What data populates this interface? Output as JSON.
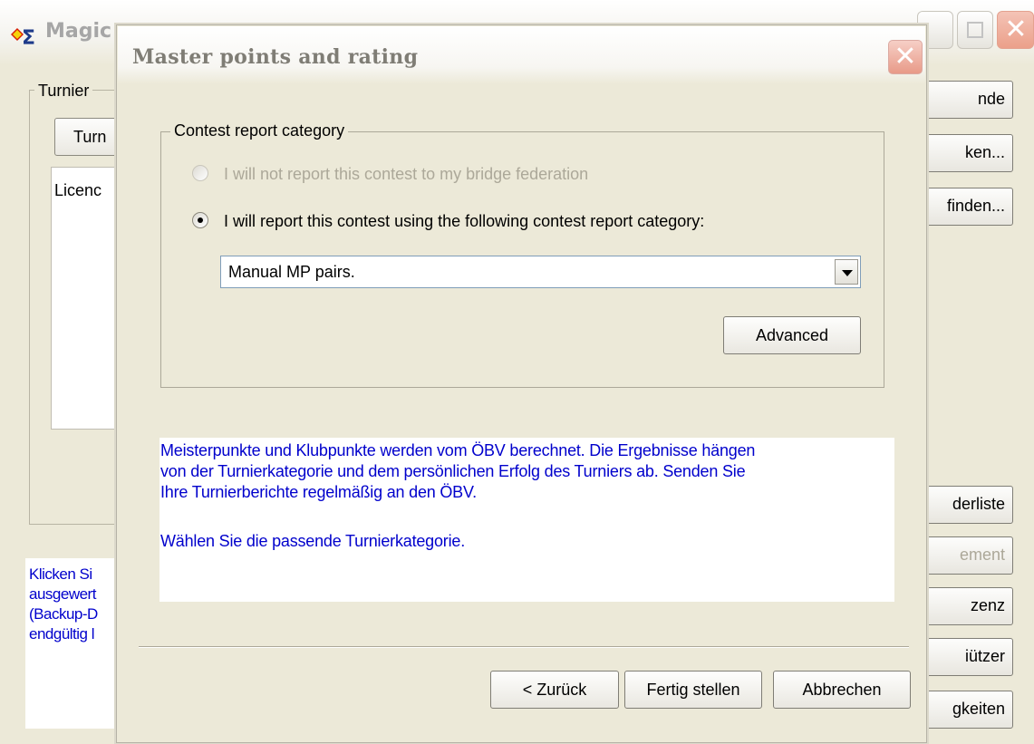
{
  "main_window": {
    "title": "Magic",
    "turnier_group_label": "Turnier",
    "turn_button_label": "Turn",
    "licence_text": "Licenc",
    "info_lines": [
      "Klicken Si",
      "ausgewert",
      "(Backup-D",
      "endgültig l"
    ],
    "right_buttons": [
      {
        "label": "nde",
        "enabled": true
      },
      {
        "label": "ken...",
        "enabled": true
      },
      {
        "label": "finden...",
        "enabled": true
      },
      {
        "label": "derliste",
        "enabled": true
      },
      {
        "label": "ement",
        "enabled": false
      },
      {
        "label": "zenz",
        "enabled": true
      },
      {
        "label": "iützer",
        "enabled": true
      },
      {
        "label": "gkeiten",
        "enabled": true
      }
    ]
  },
  "dialog": {
    "title": "Master points and rating",
    "group_label": "Contest report category",
    "radio_options": [
      {
        "label": "I will not report this contest to my bridge federation",
        "selected": false,
        "enabled": false
      },
      {
        "label": "I will report this contest using the following contest report category:",
        "selected": true,
        "enabled": true
      }
    ],
    "category_select": {
      "value": "Manual MP pairs."
    },
    "advanced_label": "Advanced",
    "description": {
      "lines": [
        "Meisterpunkte und Klubpunkte werden vom ÖBV berechnet. Die Ergebnisse hängen",
        "von der Turnierkategorie und dem persönlichen Erfolg des Turniers ab. Senden Sie",
        "Ihre Turnierberichte regelmäßig an den ÖBV."
      ],
      "hint": "Wählen Sie die passende Turnierkategorie."
    },
    "buttons": {
      "back": "< Zurück",
      "finish": "Fertig stellen",
      "cancel": "Abbrechen"
    }
  },
  "colors": {
    "window_face": "#ece9d8",
    "info_text": "#0000cc",
    "disabled_text": "#aca899",
    "close_button": "#e89a88"
  }
}
